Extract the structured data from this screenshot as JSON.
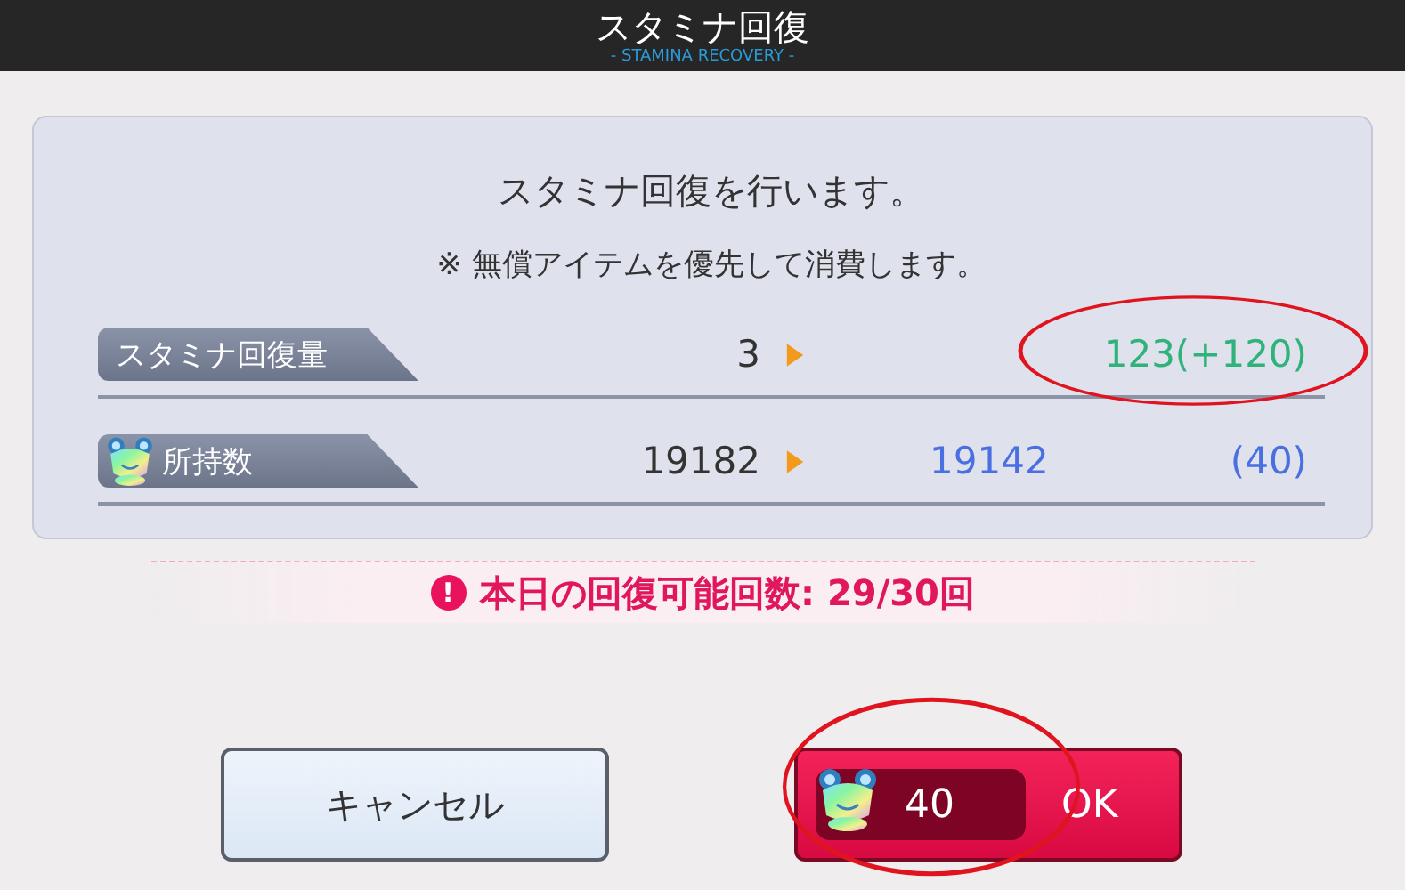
{
  "header": {
    "title": "スタミナ回復",
    "subtitle": "- STAMINA RECOVERY -"
  },
  "message": {
    "line": "スタミナ回復を行います。",
    "note": "※ 無償アイテムを優先して消費します。"
  },
  "rows": [
    {
      "kind": "stamina",
      "label": "スタミナ回復量",
      "before": "3",
      "after": "123(+120)",
      "change": "",
      "circled": true
    },
    {
      "kind": "item",
      "label": "所持数",
      "before": "19182",
      "after": "19142",
      "change": "(40)",
      "circled": false
    }
  ],
  "notice": {
    "icon": "!",
    "text": "本日の回復可能回数: 29/30回"
  },
  "buttons": {
    "cancel": "キャンセル",
    "ok": {
      "cost": "40",
      "label": "OK",
      "circled": true
    }
  }
}
